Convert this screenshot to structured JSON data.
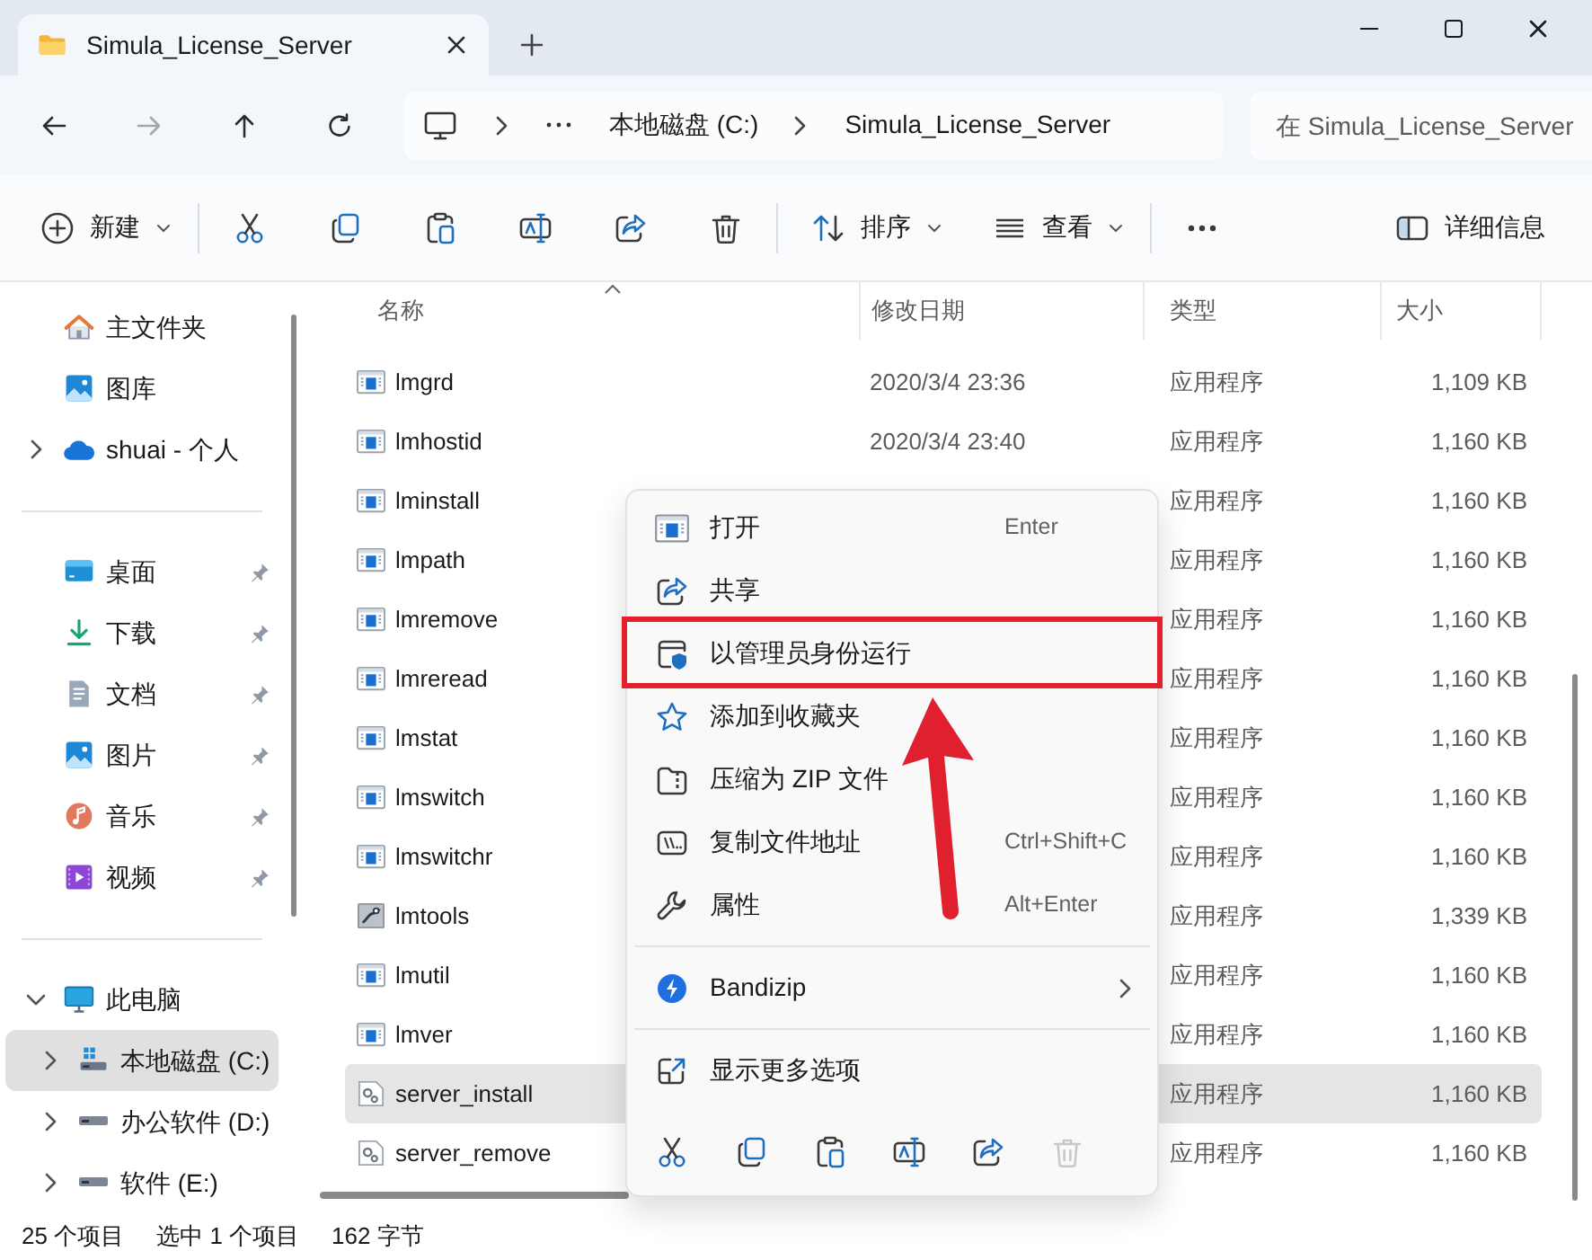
{
  "tabs": [
    {
      "label": "Simula_License_Server",
      "selected": true
    }
  ],
  "nav": [
    {
      "kind": "back",
      "disabled": false
    },
    {
      "kind": "forward",
      "disabled": true
    },
    {
      "kind": "up",
      "disabled": false
    },
    {
      "kind": "refresh",
      "disabled": false
    }
  ],
  "address_bar": {
    "crumbs": [
      "本地磁盘 (C:)",
      "Simula_License_Server"
    ]
  },
  "search": {
    "placeholder": "在 Simula_License_Server"
  },
  "toolbar": [
    {
      "kind": "new",
      "label": "新建",
      "dropdown": true
    },
    {
      "kind": "separator"
    },
    {
      "kind": "cut"
    },
    {
      "kind": "copy"
    },
    {
      "kind": "paste"
    },
    {
      "kind": "rename"
    },
    {
      "kind": "share"
    },
    {
      "kind": "delete"
    },
    {
      "kind": "separator"
    },
    {
      "kind": "sort",
      "label": "排序",
      "dropdown": true
    },
    {
      "kind": "view",
      "label": "查看",
      "dropdown": true
    },
    {
      "kind": "separator"
    },
    {
      "kind": "more"
    },
    {
      "kind": "details",
      "label": "详细信息"
    }
  ],
  "sidebar": {
    "sections": [
      [
        {
          "kind": "home",
          "label": "主文件夹",
          "selected": false
        },
        {
          "kind": "gallery",
          "label": "图库",
          "selected": false
        },
        {
          "kind": "cloud",
          "label": "shuai - 个人",
          "expanded": false,
          "selected": false
        }
      ],
      [
        {
          "kind": "desktop",
          "label": "桌面",
          "pinned": true,
          "selected": false
        },
        {
          "kind": "downloads",
          "label": "下载",
          "pinned": true,
          "selected": false
        },
        {
          "kind": "documents",
          "label": "文档",
          "pinned": true,
          "selected": false
        },
        {
          "kind": "pictures",
          "label": "图片",
          "pinned": true,
          "selected": false
        },
        {
          "kind": "music",
          "label": "音乐",
          "pinned": true,
          "selected": false
        },
        {
          "kind": "videos",
          "label": "视频",
          "pinned": true,
          "selected": false
        }
      ],
      [
        {
          "kind": "pc",
          "label": "此电脑",
          "expanded": true,
          "selected": false,
          "children": [
            {
              "kind": "system_drive",
              "label": "本地磁盘 (C:)",
              "expanded": false,
              "selected": true
            },
            {
              "kind": "drive",
              "label": "办公软件 (D:)",
              "expanded": false,
              "selected": false
            },
            {
              "kind": "drive",
              "label": "软件 (E:)",
              "expanded": false,
              "selected": false
            }
          ]
        }
      ]
    ]
  },
  "file_list": {
    "columns": [
      {
        "label": "名称",
        "sorted": true
      },
      {
        "label": "修改日期",
        "sorted": false
      },
      {
        "label": "类型",
        "sorted": false
      },
      {
        "label": "大小",
        "sorted": false
      }
    ],
    "rows": [
      {
        "name": "lmgrd",
        "kind": "app",
        "modified": "2020/3/4 23:36",
        "type": "应用程序",
        "size": "1,109 KB",
        "selected": false
      },
      {
        "name": "lmhostid",
        "kind": "app",
        "modified": "2020/3/4 23:40",
        "type": "应用程序",
        "size": "1,160 KB",
        "selected": false
      },
      {
        "name": "lminstall",
        "kind": "app",
        "type": "应用程序",
        "size": "1,160 KB",
        "selected": false
      },
      {
        "name": "lmpath",
        "kind": "app",
        "type": "应用程序",
        "size": "1,160 KB",
        "selected": false
      },
      {
        "name": "lmremove",
        "kind": "app",
        "type": "应用程序",
        "size": "1,160 KB",
        "selected": false
      },
      {
        "name": "lmreread",
        "kind": "app",
        "type": "应用程序",
        "size": "1,160 KB",
        "selected": false
      },
      {
        "name": "lmstat",
        "kind": "app",
        "type": "应用程序",
        "size": "1,160 KB",
        "selected": false
      },
      {
        "name": "lmswitch",
        "kind": "app",
        "type": "应用程序",
        "size": "1,160 KB",
        "selected": false
      },
      {
        "name": "lmswitchr",
        "kind": "app",
        "type": "应用程序",
        "size": "1,160 KB",
        "selected": false
      },
      {
        "name": "lmtools",
        "kind": "tools",
        "type": "应用程序",
        "size": "1,339 KB",
        "selected": false
      },
      {
        "name": "lmutil",
        "kind": "app",
        "type": "应用程序",
        "size": "1,160 KB",
        "selected": false
      },
      {
        "name": "lmver",
        "kind": "app",
        "type": "应用程序",
        "size": "1,160 KB",
        "selected": false
      },
      {
        "name": "server_install",
        "kind": "script",
        "type": "应用程序",
        "size": "1,160 KB",
        "selected": true
      },
      {
        "name": "server_remove",
        "kind": "script",
        "type": "应用程序",
        "size": "1,160 KB",
        "selected": false
      }
    ]
  },
  "context_menu": {
    "items": [
      {
        "kind": "open",
        "label": "打开",
        "shortcut": "Enter",
        "highlighted": false
      },
      {
        "kind": "share",
        "label": "共享",
        "highlighted": false
      },
      {
        "kind": "run_as_admin",
        "label": "以管理员身份运行",
        "highlighted": true
      },
      {
        "kind": "add_favorite",
        "label": "添加到收藏夹",
        "highlighted": false
      },
      {
        "kind": "compress_zip",
        "label": "压缩为 ZIP 文件",
        "highlighted": false
      },
      {
        "kind": "copy_path",
        "label": "复制文件地址",
        "shortcut": "Ctrl+Shift+C",
        "highlighted": false
      },
      {
        "kind": "properties",
        "label": "属性",
        "shortcut": "Alt+Enter",
        "highlighted": false
      },
      {
        "kind": "separator"
      },
      {
        "kind": "bandizip",
        "label": "Bandizip",
        "highlighted": false
      },
      {
        "kind": "separator"
      },
      {
        "kind": "more_options",
        "label": "显示更多选项",
        "highlighted": false
      }
    ],
    "quick_actions": [
      {
        "kind": "cut",
        "faded": false
      },
      {
        "kind": "copy",
        "faded": false
      },
      {
        "kind": "paste",
        "faded": false
      },
      {
        "kind": "rename",
        "faded": false
      },
      {
        "kind": "share",
        "faded": false
      },
      {
        "kind": "delete",
        "faded": true
      }
    ]
  },
  "status_bar": [
    "25 个项目",
    "选中 1 个项目",
    "162 字节"
  ]
}
